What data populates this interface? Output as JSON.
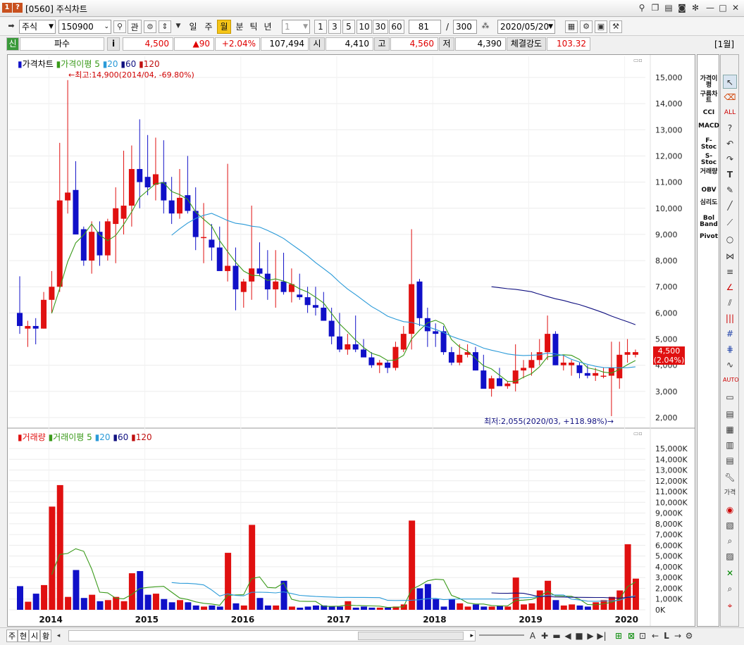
{
  "window": {
    "badge": "1",
    "help": "?",
    "title": "[0560] 주식차트"
  },
  "toolbar": {
    "market": "주식",
    "code": "150900",
    "fav": "관",
    "periods": [
      "일",
      "주",
      "월",
      "분",
      "틱",
      "년"
    ],
    "selected_period": "월",
    "interval": "1",
    "intervals": [
      "1",
      "3",
      "5",
      "10",
      "30",
      "60"
    ],
    "count": "81",
    "slash": "/",
    "total": "300",
    "date": "2020/05/20"
  },
  "quote": {
    "tag": "신",
    "name": "파수",
    "info": "i",
    "price": "4,500",
    "change": "▲90",
    "change_pct": "+2.04%",
    "volume": "107,494",
    "open_label": "시",
    "open": "4,410",
    "high_label": "고",
    "high": "4,560",
    "low_label": "저",
    "low": "4,390",
    "strength_label": "체결강도",
    "strength": "103.32",
    "period_tag": "[1월]"
  },
  "price_legend": {
    "name": "가격차트",
    "ma_label": "가격이평",
    "ma": [
      "5",
      "20",
      "60",
      "120"
    ]
  },
  "volume_legend": {
    "name": "거래량",
    "ma_label": "거래이평",
    "ma": [
      "5",
      "20",
      "60",
      "120"
    ]
  },
  "annotations": {
    "high": "←최고:14,900(2014/04, -69.80%)",
    "low": "최저:2,055(2020/03, +118.98%)→"
  },
  "current_tag": {
    "price": "4,500",
    "pct": "(2.04%)"
  },
  "indicators": [
    "가격이평",
    "구름차트",
    "CCI",
    "MACD",
    "F-Stoc",
    "S-Stoc",
    "거래량",
    "OBV",
    "심리도",
    "Bol Band",
    "Pivot"
  ],
  "bottom_tabs": [
    "주",
    "현",
    "시",
    "황"
  ],
  "colors": {
    "up": "#e01010",
    "down": "#1010c8",
    "ma5": "#3a9a1a",
    "ma20": "#2a9ad8",
    "ma60": "#101080",
    "ma120": "#c01010"
  },
  "chart_data": {
    "type": "candlestick",
    "x_labels": [
      "2014",
      "2015",
      "2016",
      "2017",
      "2018",
      "2019",
      "2020"
    ],
    "price_ticks": [
      "15,000",
      "14,000",
      "13,000",
      "12,000",
      "11,000",
      "10,000",
      "9,000",
      "8,000",
      "7,000",
      "6,000",
      "5,000",
      "4,000",
      "3,000",
      "2,000"
    ],
    "volume_ticks": [
      "15,000K",
      "14,000K",
      "13,000K",
      "12,000K",
      "11,000K",
      "10,000K",
      "9,000K",
      "8,000K",
      "7,000K",
      "6,000K",
      "5,000K",
      "4,000K",
      "3,000K",
      "2,000K",
      "1,000K",
      "0K"
    ],
    "candles": [
      [
        6000,
        7400,
        5200,
        5500,
        2200
      ],
      [
        5400,
        5700,
        4700,
        5500,
        750
      ],
      [
        5500,
        5800,
        4800,
        5400,
        1500
      ],
      [
        5400,
        6800,
        5400,
        6500,
        2300
      ],
      [
        6500,
        7600,
        6000,
        7000,
        9600
      ],
      [
        7000,
        12500,
        6800,
        10300,
        11600
      ],
      [
        10300,
        14900,
        9800,
        10600,
        1200
      ],
      [
        10700,
        11800,
        9000,
        9000,
        3700
      ],
      [
        9200,
        9300,
        7800,
        8000,
        1100
      ],
      [
        8000,
        9500,
        7500,
        9100,
        1400
      ],
      [
        9100,
        9500,
        7800,
        8200,
        800
      ],
      [
        8200,
        9600,
        8000,
        9500,
        900
      ],
      [
        9400,
        10800,
        7900,
        10000,
        1200
      ],
      [
        9600,
        12200,
        9000,
        10100,
        800
      ],
      [
        10100,
        12400,
        9300,
        11500,
        3400
      ],
      [
        11500,
        13400,
        10000,
        11000,
        3600
      ],
      [
        11200,
        12800,
        10500,
        10800,
        1400
      ],
      [
        10900,
        12700,
        10300,
        11300,
        1500
      ],
      [
        11000,
        12600,
        9800,
        10300,
        1000
      ],
      [
        10300,
        11200,
        9400,
        9800,
        700
      ],
      [
        9800,
        11500,
        9600,
        10400,
        900
      ],
      [
        10500,
        12000,
        9800,
        9900,
        700
      ],
      [
        9900,
        10800,
        8400,
        8900,
        400
      ],
      [
        8900,
        10200,
        7900,
        8900,
        300
      ],
      [
        8800,
        9400,
        8000,
        8500,
        400
      ],
      [
        8500,
        9300,
        7800,
        7600,
        300
      ],
      [
        7600,
        11700,
        7200,
        7800,
        5300
      ],
      [
        7800,
        8500,
        6100,
        6900,
        600
      ],
      [
        6800,
        7300,
        6200,
        7200,
        400
      ],
      [
        7200,
        10100,
        6500,
        7700,
        7900
      ],
      [
        7700,
        8700,
        7400,
        7500,
        1100
      ],
      [
        7500,
        8400,
        6500,
        6900,
        400
      ],
      [
        6900,
        8400,
        6200,
        7200,
        400
      ],
      [
        7200,
        8300,
        6700,
        6800,
        2700
      ],
      [
        6800,
        7700,
        6400,
        7100,
        300
      ],
      [
        6700,
        7500,
        6500,
        6600,
        200
      ],
      [
        6600,
        7000,
        6000,
        6300,
        300
      ],
      [
        6300,
        7000,
        5900,
        6200,
        400
      ],
      [
        6200,
        6800,
        5700,
        5700,
        400
      ],
      [
        5700,
        6200,
        4800,
        5100,
        300
      ],
      [
        5100,
        6000,
        4500,
        4600,
        300
      ],
      [
        4600,
        5200,
        4400,
        4800,
        800
      ],
      [
        4800,
        5900,
        4500,
        4600,
        200
      ],
      [
        4600,
        5000,
        4400,
        4300,
        300
      ],
      [
        4300,
        4500,
        3900,
        4000,
        200
      ],
      [
        4000,
        4200,
        3700,
        4100,
        200
      ],
      [
        4100,
        4200,
        3700,
        3900,
        200
      ],
      [
        3900,
        4900,
        3800,
        4700,
        300
      ],
      [
        4600,
        5500,
        4500,
        5200,
        500
      ],
      [
        5200,
        9200,
        4600,
        7100,
        8300
      ],
      [
        7200,
        7300,
        5500,
        5800,
        2000
      ],
      [
        5800,
        6200,
        4700,
        5300,
        2400
      ],
      [
        5300,
        5600,
        4700,
        5200,
        1000
      ],
      [
        5300,
        5500,
        4400,
        4500,
        300
      ],
      [
        4500,
        4700,
        4000,
        4100,
        1000
      ],
      [
        4100,
        4800,
        4000,
        4400,
        600
      ],
      [
        4400,
        4800,
        4300,
        4500,
        300
      ],
      [
        4500,
        4700,
        3800,
        3800,
        500
      ],
      [
        3800,
        4400,
        3500,
        3100,
        300
      ],
      [
        3100,
        3600,
        2800,
        3500,
        300
      ],
      [
        3500,
        3900,
        3300,
        3200,
        400
      ],
      [
        3200,
        3400,
        3100,
        3300,
        300
      ],
      [
        3300,
        4800,
        3000,
        3800,
        3000
      ],
      [
        3800,
        4200,
        3500,
        3900,
        500
      ],
      [
        3900,
        4500,
        3600,
        4200,
        600
      ],
      [
        4200,
        5000,
        4000,
        4500,
        1800
      ],
      [
        4500,
        5900,
        4200,
        5200,
        2700
      ],
      [
        5200,
        5300,
        4000,
        4000,
        900
      ],
      [
        4000,
        4400,
        3800,
        4100,
        400
      ],
      [
        4000,
        4200,
        3600,
        4100,
        500
      ],
      [
        4000,
        4100,
        3500,
        3700,
        400
      ],
      [
        3700,
        4000,
        3500,
        3600,
        300
      ],
      [
        3600,
        3900,
        3400,
        3700,
        700
      ],
      [
        3600,
        3900,
        3500,
        3600,
        900
      ],
      [
        3600,
        4900,
        2055,
        3900,
        1200
      ],
      [
        3500,
        4900,
        3100,
        4400,
        1800
      ],
      [
        4400,
        5000,
        4100,
        4500,
        6100
      ],
      [
        4400,
        4600,
        4300,
        4500,
        2900
      ]
    ]
  }
}
